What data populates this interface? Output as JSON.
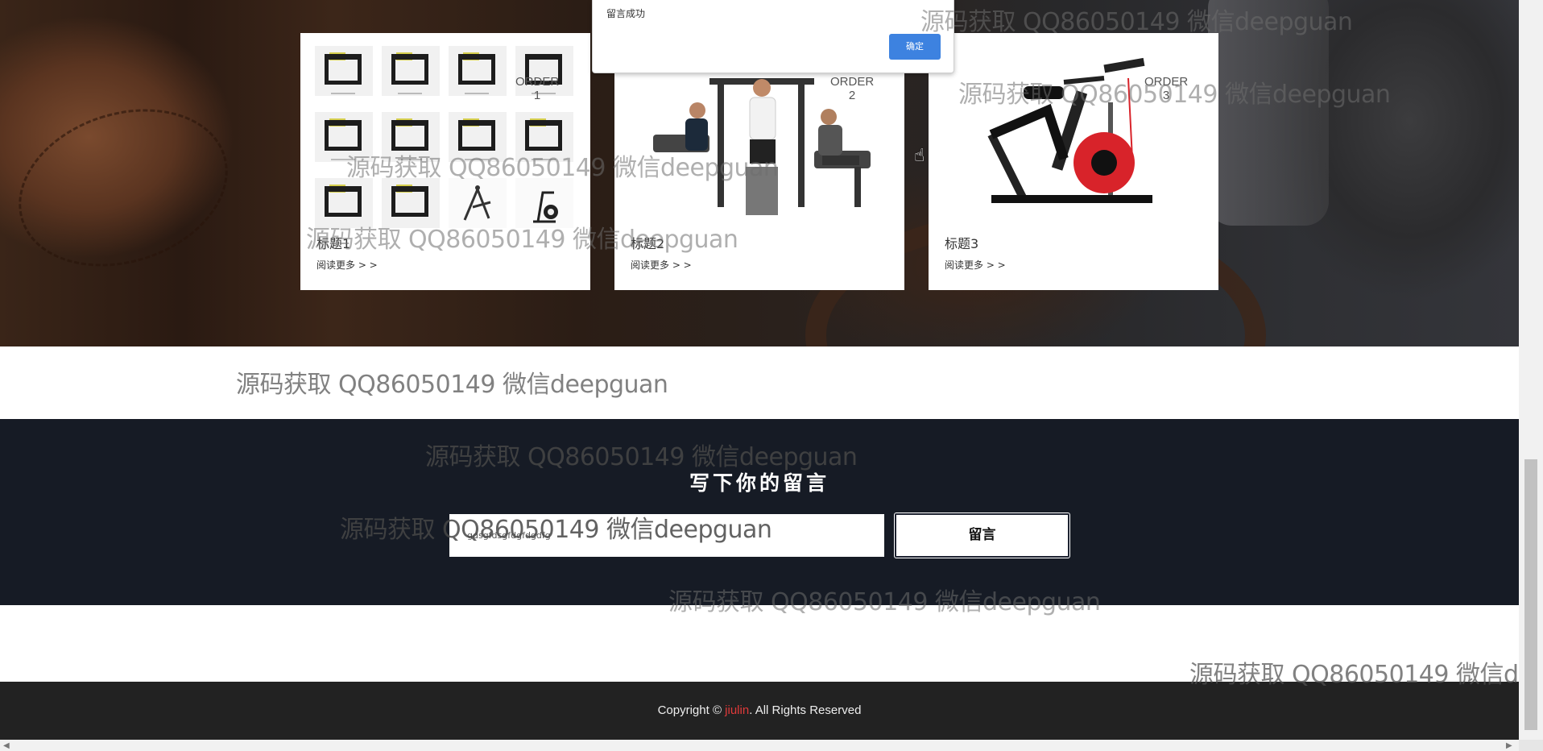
{
  "cards": [
    {
      "order": "ORDER\n1",
      "title": "标题1",
      "read_more": "阅读更多 > >",
      "image": "gym-equipment-catalog"
    },
    {
      "order": "ORDER\n2",
      "title": "标题2",
      "read_more": "阅读更多 > >",
      "image": "multi-station-gym-people"
    },
    {
      "order": "ORDER\n3",
      "title": "标题3",
      "read_more": "阅读更多 > >",
      "image": "spin-bike"
    }
  ],
  "dialog": {
    "message": "留言成功",
    "ok_label": "确定"
  },
  "message_section": {
    "heading": "写下你的留言",
    "input_value": "gdsgfdsgfdgfdgdfg",
    "submit_label": "留言"
  },
  "footer": {
    "prefix": "Copyright © ",
    "brand": "jiulin",
    "suffix": ". All Rights Reserved",
    "brand_color": "#e03a3a"
  },
  "watermark": {
    "text": "源码获取 QQ86050149 微信deepguan"
  },
  "colors": {
    "band_bg": "#161b25",
    "footer_bg": "#222222",
    "ok_button": "#3d82e0"
  }
}
